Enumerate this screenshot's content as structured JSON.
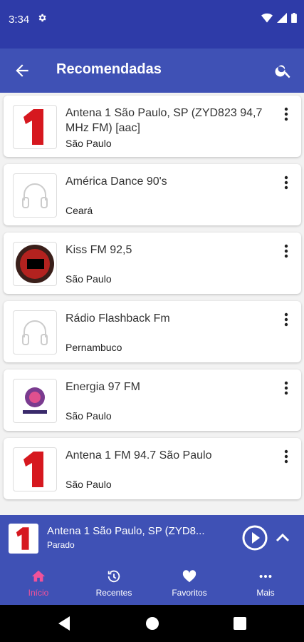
{
  "status_bar": {
    "time": "3:34"
  },
  "app_bar": {
    "title": "Recomendadas"
  },
  "stations": [
    {
      "name": "Antena 1 São Paulo, SP (ZYD823 94,7 MHz FM) [aac]",
      "region": "São Paulo",
      "logo": "antena1-logo"
    },
    {
      "name": "América Dance 90's",
      "region": "Ceará",
      "logo": "headphones-icon"
    },
    {
      "name": "Kiss FM 92,5",
      "region": "São Paulo",
      "logo": "kiss-fm-logo"
    },
    {
      "name": "Rádio Flashback Fm",
      "region": "Pernambuco",
      "logo": "headphones-icon"
    },
    {
      "name": "Energia 97 FM",
      "region": "São Paulo",
      "logo": "energia-logo"
    },
    {
      "name": "Antena 1 FM 94.7 São Paulo",
      "region": "São Paulo",
      "logo": "antena1-logo"
    }
  ],
  "player": {
    "title": "Antena 1 São Paulo, SP (ZYD8...",
    "status": "Parado"
  },
  "bottom_nav": [
    {
      "label": "Início",
      "icon": "home-icon",
      "active": true
    },
    {
      "label": "Recentes",
      "icon": "history-icon",
      "active": false
    },
    {
      "label": "Favoritos",
      "icon": "heart-icon",
      "active": false
    },
    {
      "label": "Mais",
      "icon": "more-horiz-icon",
      "active": false
    }
  ],
  "colors": {
    "primary": "#3f51b5",
    "status_bar": "#2e3ba8",
    "active_nav": "#f0529a",
    "background": "#f2f2f2"
  }
}
